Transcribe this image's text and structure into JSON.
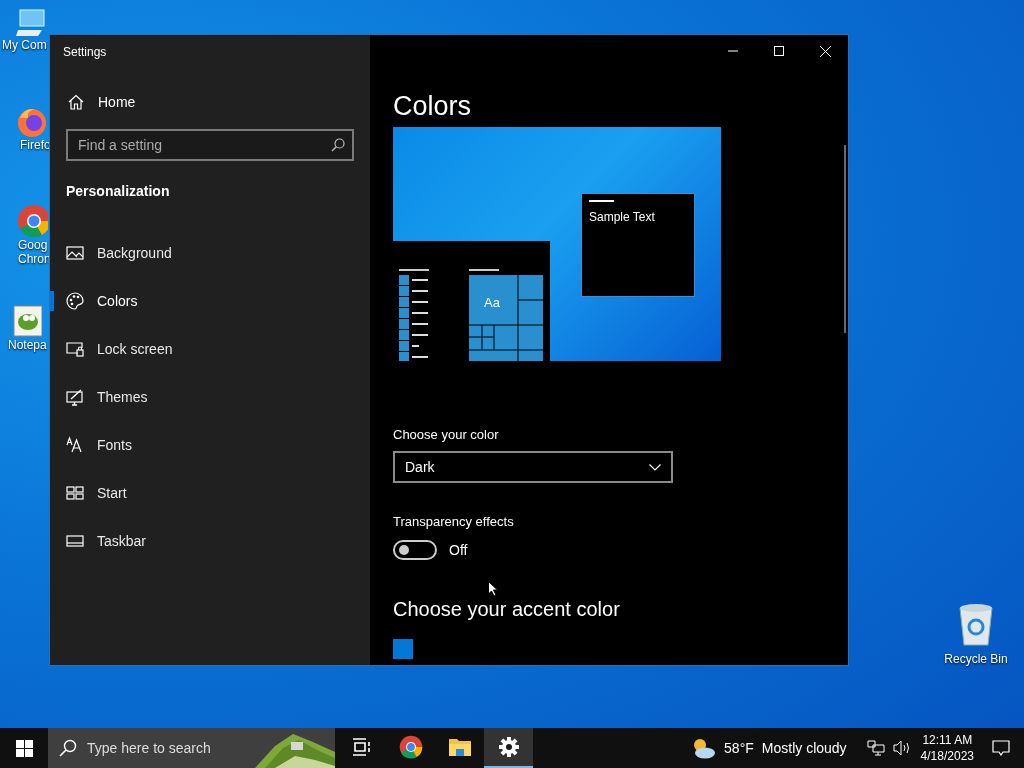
{
  "desktop_icons": [
    {
      "label_lines": [
        "My Com"
      ]
    },
    {
      "label_lines": [
        "Firefo"
      ]
    },
    {
      "label_lines": [
        "Goog",
        "Chron"
      ]
    },
    {
      "label_lines": [
        "Notepa"
      ]
    }
  ],
  "recycle_bin": {
    "label": "Recycle Bin"
  },
  "window": {
    "title": "Settings",
    "sidebar": {
      "home": "Home",
      "search": {
        "placeholder": "Find a setting"
      },
      "section": "Personalization",
      "items": [
        {
          "label": "Background",
          "selected": false
        },
        {
          "label": "Colors",
          "selected": true
        },
        {
          "label": "Lock screen",
          "selected": false
        },
        {
          "label": "Themes",
          "selected": false
        },
        {
          "label": "Fonts",
          "selected": false
        },
        {
          "label": "Start",
          "selected": false
        },
        {
          "label": "Taskbar",
          "selected": false
        }
      ]
    },
    "content": {
      "title": "Colors",
      "preview": {
        "sample_text": "Sample Text",
        "tile_text": "Aa"
      },
      "color_mode": {
        "label": "Choose your color",
        "value": "Dark"
      },
      "transparency": {
        "label": "Transparency effects",
        "on": false,
        "state_text": "Off"
      },
      "accent": {
        "heading": "Choose your accent color",
        "auto_checkbox": {
          "checked": true
        }
      }
    }
  },
  "taskbar": {
    "search": {
      "placeholder": "Type here to search"
    },
    "apps": [
      {
        "selected": false
      },
      {
        "selected": false
      },
      {
        "selected": false
      },
      {
        "selected": true
      }
    ],
    "weather": {
      "temp": "58°F",
      "condition": "Mostly cloudy"
    },
    "time": "12:11 AM",
    "date": "4/18/2023"
  }
}
